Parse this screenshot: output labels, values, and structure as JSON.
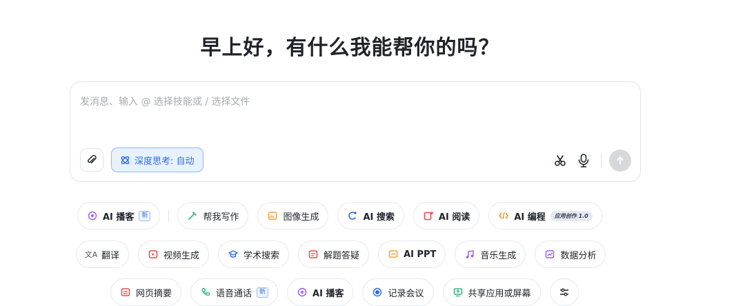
{
  "greeting": "早上好，有什么我能帮你的吗？",
  "composer": {
    "placeholder": "发消息、输入 @ 选择技能或 / 选择文件",
    "deep_think_label": "深度思考: 自动"
  },
  "row1": {
    "ai_podcast": "AI 播客",
    "new_badge": "新",
    "help_write": "帮我写作",
    "image_gen": "图像生成",
    "ai_search": "AI 搜索",
    "ai_read": "AI 阅读",
    "ai_code": "AI 编程",
    "app_create_badge": "应用创作 1.0"
  },
  "row2": {
    "translate": "翻译",
    "video_gen": "视频生成",
    "academic_search": "学术搜索",
    "problem_solve": "解题答疑",
    "ai_ppt": "AI PPT",
    "music_gen": "音乐生成",
    "data_analysis": "数据分析"
  },
  "row3": {
    "web_summary": "网页摘要",
    "voice_call": "语音通话",
    "new_badge": "新",
    "ai_podcast": "AI 播客",
    "record_meeting": "记录会议",
    "share_screen": "共享应用或屏幕"
  },
  "colors": {
    "accent_blue": "#2f6ddc",
    "podcast_purple": "#a35cf0",
    "write_green": "#36b37e",
    "image_orange": "#f2a33a",
    "read_red": "#e8484a",
    "code_orange": "#f08c2e"
  }
}
